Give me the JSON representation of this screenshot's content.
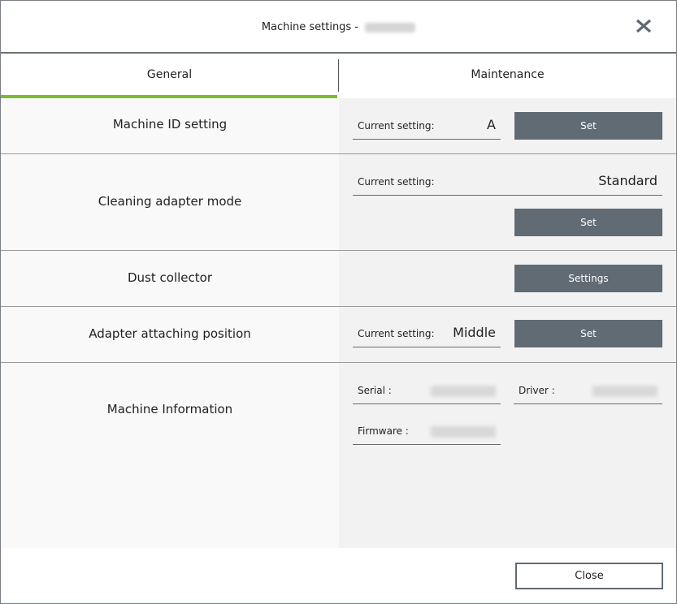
{
  "window": {
    "title": "Machine settings -",
    "title_suffix_redacted": true,
    "close_icon": "close-x-icon"
  },
  "tabs": [
    {
      "label": "General",
      "active": true
    },
    {
      "label": "Maintenance",
      "active": false
    }
  ],
  "colors": {
    "active_tab_underline": "#7cbd2e",
    "button_bg": "#606b74",
    "button_text": "#ffffff",
    "panel_bg": "#f2f2f2",
    "label_bg": "#f9f9f9"
  },
  "rows": {
    "machine_id": {
      "label": "Machine ID setting",
      "current_label": "Current setting:",
      "current_value": "A",
      "button": "Set"
    },
    "cleaning_adapter": {
      "label": "Cleaning adapter mode",
      "current_label": "Current setting:",
      "current_value": "Standard",
      "button": "Set"
    },
    "dust_collector": {
      "label": "Dust collector",
      "button": "Settings"
    },
    "adapter_position": {
      "label": "Adapter attaching position",
      "current_label": "Current setting:",
      "current_value": "Middle",
      "button": "Set"
    },
    "machine_info": {
      "label": "Machine Information",
      "serial_label": "Serial :",
      "driver_label": "Driver :",
      "firmware_label": "Firmware :"
    }
  },
  "footer": {
    "close_button": "Close"
  }
}
